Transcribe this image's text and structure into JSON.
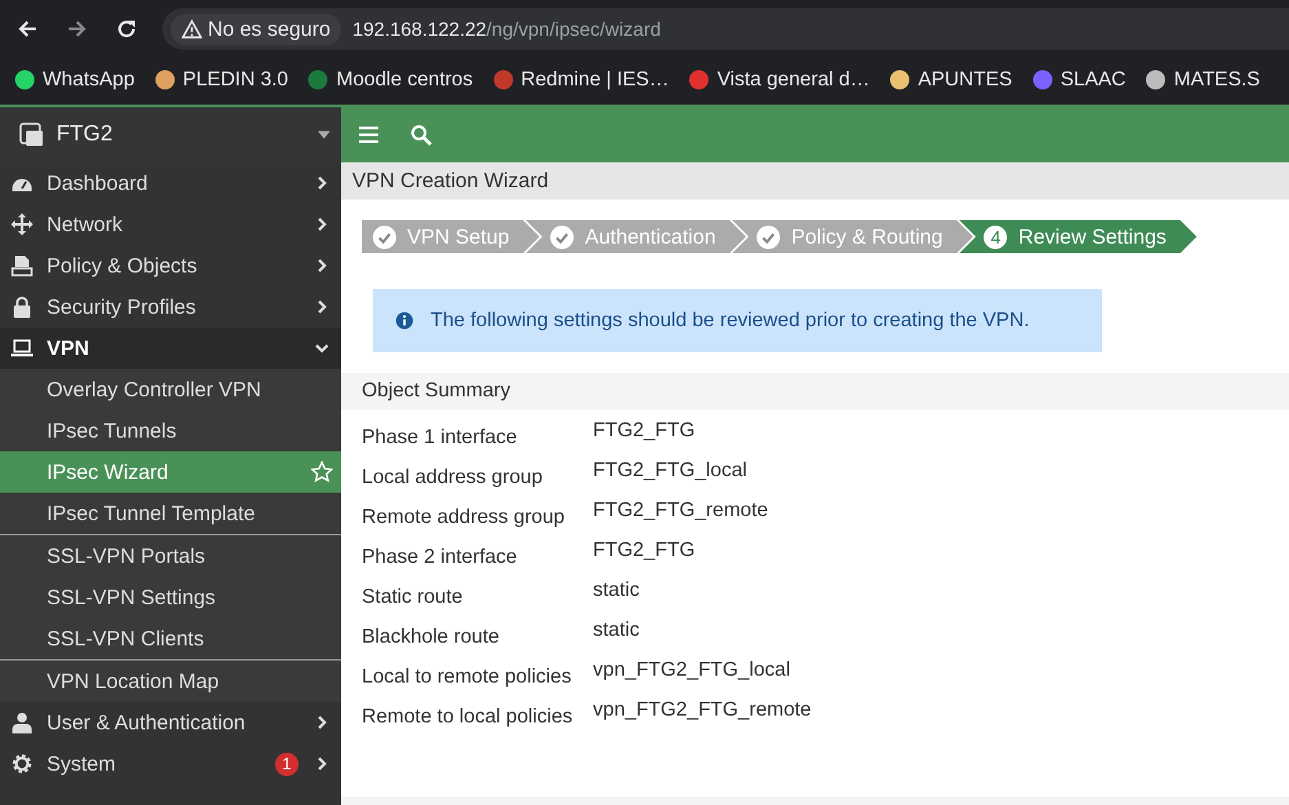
{
  "browser": {
    "security_label": "No es seguro",
    "url_host": "192.168.122.22",
    "url_path": "/ng/vpn/ipsec/wizard",
    "bookmarks": [
      {
        "label": "WhatsApp"
      },
      {
        "label": "PLEDIN 3.0"
      },
      {
        "label": "Moodle centros"
      },
      {
        "label": "Redmine | IES…"
      },
      {
        "label": "Vista general d…"
      },
      {
        "label": "APUNTES"
      },
      {
        "label": "SLAAC"
      },
      {
        "label": "MATES.S"
      }
    ]
  },
  "sidebar": {
    "device": "FTG2",
    "items": [
      {
        "label": "Dashboard",
        "expanded": false,
        "active": false
      },
      {
        "label": "Network",
        "expanded": false,
        "active": false
      },
      {
        "label": "Policy & Objects",
        "expanded": false,
        "active": false
      },
      {
        "label": "Security Profiles",
        "expanded": false,
        "active": false
      },
      {
        "label": "VPN",
        "expanded": true,
        "active": true,
        "sections": [
          {
            "children": [
              {
                "label": "Overlay Controller VPN",
                "selected": false
              },
              {
                "label": "IPsec Tunnels",
                "selected": false
              },
              {
                "label": "IPsec Wizard",
                "selected": true
              },
              {
                "label": "IPsec Tunnel Template",
                "selected": false
              }
            ]
          },
          {
            "children": [
              {
                "label": "SSL-VPN Portals",
                "selected": false
              },
              {
                "label": "SSL-VPN Settings",
                "selected": false
              },
              {
                "label": "SSL-VPN Clients",
                "selected": false
              }
            ]
          },
          {
            "children": [
              {
                "label": "VPN Location Map",
                "selected": false
              }
            ]
          }
        ]
      },
      {
        "label": "User & Authentication",
        "expanded": false,
        "active": false
      },
      {
        "label": "System",
        "expanded": false,
        "active": false,
        "badge": "1"
      }
    ]
  },
  "page": {
    "title": "VPN Creation Wizard",
    "steps": [
      {
        "label": "VPN Setup",
        "completed": true,
        "selected": false
      },
      {
        "label": "Authentication",
        "completed": true,
        "selected": false
      },
      {
        "label": "Policy & Routing",
        "completed": true,
        "selected": false
      },
      {
        "label": "Review Settings",
        "number": "4",
        "completed": false,
        "selected": true
      }
    ],
    "info": "The following settings should be reviewed prior to creating the VPN.",
    "summary_title": "Object Summary",
    "summary": [
      {
        "label": "Phase 1 interface",
        "value": "FTG2_FTG"
      },
      {
        "label": "Local address group",
        "value": "FTG2_FTG_local"
      },
      {
        "label": "Remote address group",
        "value": "FTG2_FTG_remote"
      },
      {
        "label": "Phase 2 interface",
        "value": "FTG2_FTG"
      },
      {
        "label": "Static route",
        "value": "static"
      },
      {
        "label": "Blackhole route",
        "value": "static"
      },
      {
        "label": "Local to remote policies",
        "value": "vpn_FTG2_FTG_local"
      },
      {
        "label": "Remote to local policies",
        "value": "vpn_FTG2_FTG_remote"
      }
    ]
  }
}
